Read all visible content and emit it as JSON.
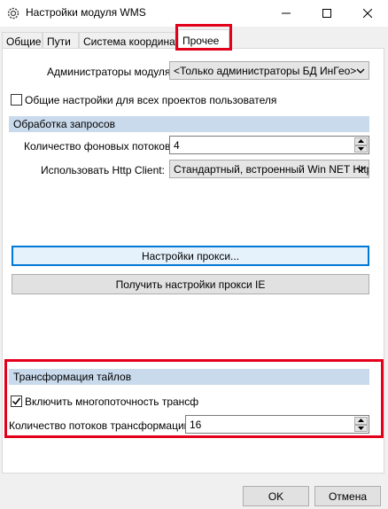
{
  "window": {
    "title": "Настройки модуля WMS",
    "controls": [
      "minimize-icon",
      "maximize-icon",
      "close-icon"
    ]
  },
  "tabs": [
    {
      "label": "Общие"
    },
    {
      "label": "Пути"
    },
    {
      "label": "Система координат"
    },
    {
      "label": "Прочее",
      "active": true
    }
  ],
  "admins": {
    "label": "Администраторы модуля:",
    "value": "<Только администраторы БД ИнГео>"
  },
  "common_settings": {
    "label": "Общие настройки для всех проектов пользователя",
    "checked": false
  },
  "requests": {
    "header": "Обработка запросов",
    "threads_label": "Количество фоновых потоков:",
    "threads_value": "4",
    "http_label": "Использовать Http Client:",
    "http_value": "Стандартный, встроенный Win NET Http"
  },
  "proxy": {
    "settings_button": "Настройки прокси...",
    "ie_button": "Получить настройки прокси IE"
  },
  "tiles": {
    "header": "Трансформация тайлов",
    "multithread_label": "Включить многопоточность трансформ",
    "multithread_checked": true,
    "threads_label": "Количество потоков трансформации:",
    "threads_value": "16"
  },
  "footer": {
    "ok_label": "OK",
    "cancel_label": "Отмена"
  },
  "colors": {
    "highlight": "#e3001b",
    "section_bg": "#c9daec",
    "focus": "#0078d7"
  }
}
